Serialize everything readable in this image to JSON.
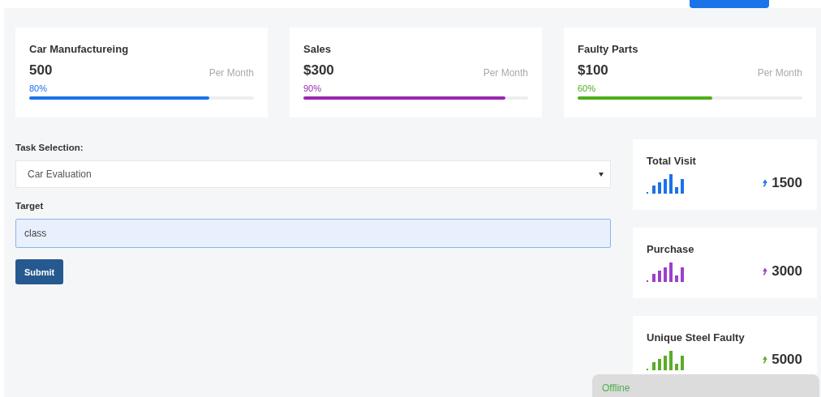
{
  "summary_cards": [
    {
      "title": "Car Manufactureing",
      "value": "500",
      "period": "Per Month",
      "percent": "80%",
      "level": 0.8,
      "color": "#1a73e8"
    },
    {
      "title": "Sales",
      "value": "$300",
      "period": "Per Month",
      "percent": "90%",
      "level": 0.9,
      "color": "#9c27b0"
    },
    {
      "title": "Faulty Parts",
      "value": "$100",
      "period": "Per Month",
      "percent": "60%",
      "level": 0.6,
      "color": "#4caf1a"
    }
  ],
  "form": {
    "task_label": "Task Selection:",
    "task_value": "Car Evaluation",
    "target_label": "Target",
    "target_value": "class",
    "submit": "Submit"
  },
  "stats": [
    {
      "title": "Total Visit",
      "value": "1500",
      "color": "#1a73e8"
    },
    {
      "title": "Purchase",
      "value": "3000",
      "color": "#9c3fc8"
    },
    {
      "title": "Unique Steel Faulty",
      "value": "5000",
      "color": "#5aac2a"
    }
  ],
  "toast": {
    "text": "Offline"
  }
}
